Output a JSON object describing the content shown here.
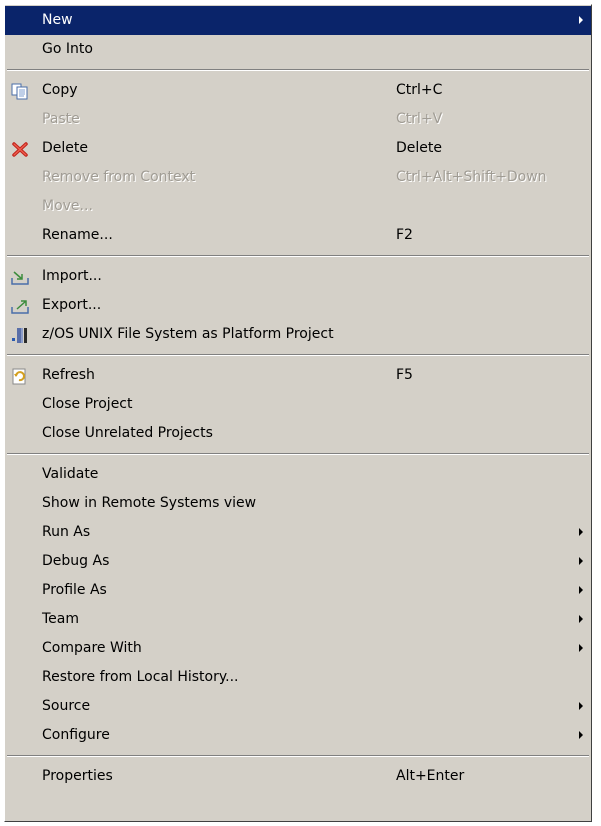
{
  "menu": {
    "items": {
      "new": {
        "label": "New"
      },
      "go_into": {
        "label": "Go Into"
      },
      "copy": {
        "label": "Copy",
        "shortcut": "Ctrl+C"
      },
      "paste": {
        "label": "Paste",
        "shortcut": "Ctrl+V"
      },
      "delete": {
        "label": "Delete",
        "shortcut": "Delete"
      },
      "remove_context": {
        "label": "Remove from Context",
        "shortcut": "Ctrl+Alt+Shift+Down"
      },
      "move": {
        "label": "Move..."
      },
      "rename": {
        "label": "Rename...",
        "shortcut": "F2"
      },
      "import": {
        "label": "Import..."
      },
      "export": {
        "label": "Export..."
      },
      "zos": {
        "label": "z/OS UNIX File System as Platform Project"
      },
      "refresh": {
        "label": "Refresh",
        "shortcut": "F5"
      },
      "close_project": {
        "label": "Close Project"
      },
      "close_unrelated": {
        "label": "Close Unrelated Projects"
      },
      "validate": {
        "label": "Validate"
      },
      "show_remote": {
        "label": "Show in Remote Systems view"
      },
      "run_as": {
        "label": "Run As"
      },
      "debug_as": {
        "label": "Debug As"
      },
      "profile_as": {
        "label": "Profile As"
      },
      "team": {
        "label": "Team"
      },
      "compare_with": {
        "label": "Compare With"
      },
      "restore_history": {
        "label": "Restore from Local History..."
      },
      "source": {
        "label": "Source"
      },
      "configure": {
        "label": "Configure"
      },
      "properties": {
        "label": "Properties",
        "shortcut": "Alt+Enter"
      }
    }
  },
  "icons": {
    "copy": "copy-icon",
    "delete": "delete-icon",
    "import": "import-icon",
    "export": "export-icon",
    "zos": "zos-project-icon",
    "refresh": "refresh-icon"
  },
  "colors": {
    "menu_bg": "#d4d0c8",
    "highlight_bg": "#0a246a",
    "disabled_text": "#a09c94"
  }
}
